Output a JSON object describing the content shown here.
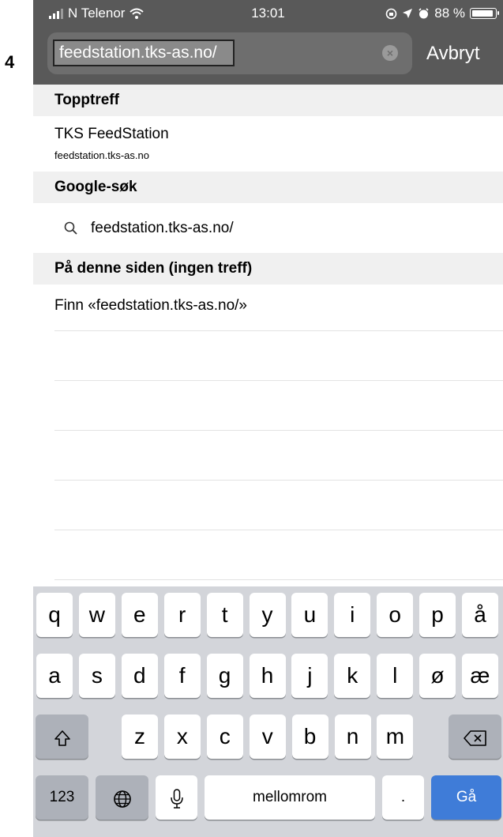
{
  "step_number": "4",
  "status_bar": {
    "carrier": "N Telenor",
    "time": "13:01",
    "battery_percent": "88 %",
    "battery_level": 0.88
  },
  "address_bar": {
    "url_text": "feedstation.tks-as.no/",
    "cancel_label": "Avbryt"
  },
  "suggestions": {
    "top_hit_header": "Topptreff",
    "top_hit_title": "TKS FeedStation",
    "top_hit_url": "feedstation.tks-as.no",
    "google_header": "Google-søk",
    "google_query": "feedstation.tks-as.no/",
    "on_page_header": "På denne siden (ingen treff)",
    "find_text": "Finn «feedstation.tks-as.no/»"
  },
  "keyboard": {
    "row1": [
      "q",
      "w",
      "e",
      "r",
      "t",
      "y",
      "u",
      "i",
      "o",
      "p",
      "å"
    ],
    "row2": [
      "a",
      "s",
      "d",
      "f",
      "g",
      "h",
      "j",
      "k",
      "l",
      "ø",
      "æ"
    ],
    "row3": [
      "z",
      "x",
      "c",
      "v",
      "b",
      "n",
      "m"
    ],
    "numbers_label": "123",
    "space_label": "mellomrom",
    "period_label": ".",
    "go_label": "Gå"
  },
  "icons": {
    "signal": "signal-bars-icon",
    "wifi": "wifi-icon",
    "lock_rotation": "orientation-lock-icon",
    "location": "location-arrow-icon",
    "alarm": "alarm-icon",
    "battery": "battery-icon",
    "clear": "clear-icon",
    "search": "search-icon",
    "shift": "shift-icon",
    "backspace": "backspace-icon",
    "globe": "globe-icon",
    "mic": "microphone-icon"
  },
  "colors": {
    "topbar": "#595959",
    "go_key": "#3f7cd8",
    "keyboard_bg": "#d3d5da"
  }
}
